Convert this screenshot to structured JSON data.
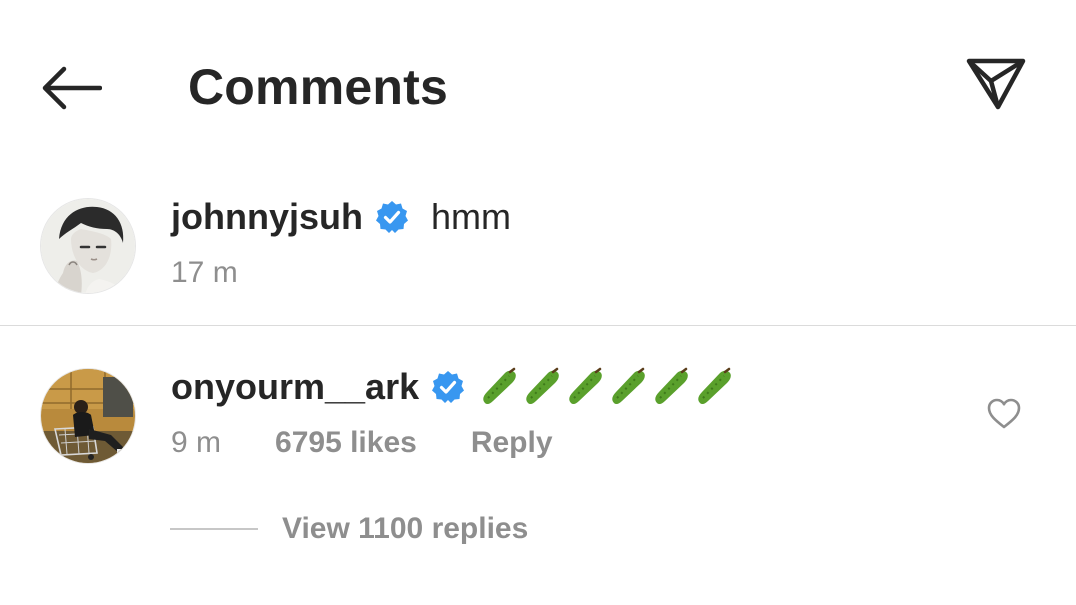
{
  "header": {
    "title": "Comments",
    "back_icon": "arrow-left-icon",
    "send_icon": "paper-plane-icon"
  },
  "caption": {
    "username": "johnnyjsuh",
    "verified": true,
    "text": "hmm",
    "time": "17 m"
  },
  "comments": [
    {
      "username": "onyourm__ark",
      "verified": true,
      "emoji": "cucumber",
      "emoji_count": 6,
      "time": "9 m",
      "likes": "6795 likes",
      "reply_label": "Reply",
      "view_replies_label": "View 1100 replies"
    }
  ],
  "colors": {
    "text": "#262626",
    "secondary": "#8e8e8e",
    "verified_blue": "#3897f0",
    "divider": "#dbdbdb"
  }
}
